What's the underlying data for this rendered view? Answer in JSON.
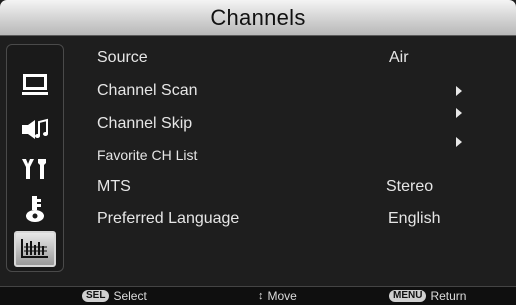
{
  "title": "Channels",
  "sidebar": {
    "icons": [
      "picture-icon",
      "audio-icon",
      "setup-icon",
      "lock-icon",
      "channels-icon"
    ],
    "selected": "channels-icon"
  },
  "menu": {
    "items": [
      {
        "label": "Source",
        "value": "Air"
      },
      {
        "label": "Channel Scan",
        "arrow": true
      },
      {
        "label": "Channel Skip",
        "arrow": true
      },
      {
        "label": "Favorite CH List",
        "arrow": true
      },
      {
        "label": "MTS",
        "value": "Stereo"
      },
      {
        "label": "Preferred Language",
        "value": "English"
      }
    ]
  },
  "footer": {
    "select_key": "SEL",
    "select_label": "Select",
    "move_label": "Move",
    "menu_key": "MENU",
    "return_label": "Return"
  },
  "colors": {
    "background": "#1e1e1e",
    "title_bar": "#cfcfcf",
    "text": "#e6e6e6",
    "footer": "#0f0f0f"
  }
}
